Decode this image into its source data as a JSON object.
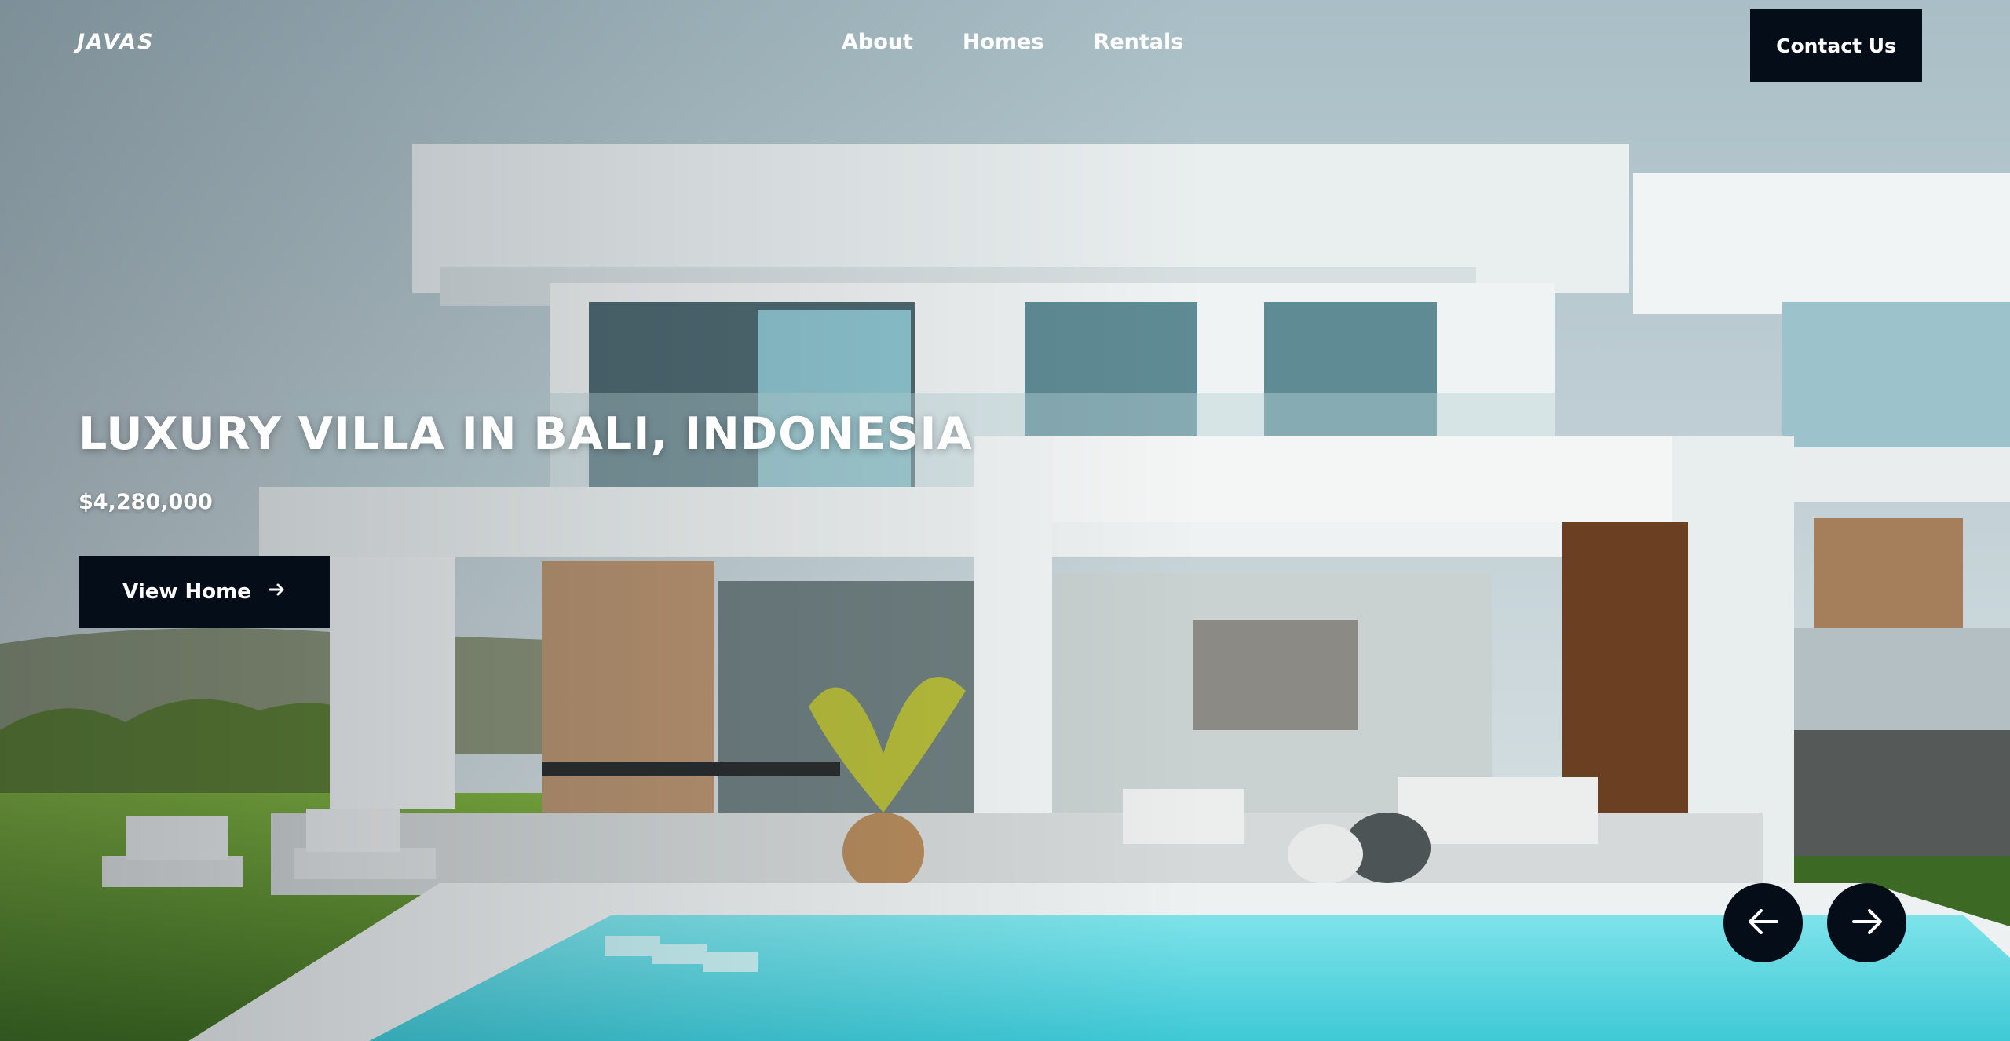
{
  "brand": {
    "logo": "JAVAS"
  },
  "nav": {
    "links": [
      "About",
      "Homes",
      "Rentals"
    ],
    "contact_label": "Contact Us"
  },
  "hero": {
    "title": "LUXURY VILLA IN BALI, INDONESIA",
    "price": "$4,280,000",
    "cta_label": "View Home",
    "cta_icon": "arrow-right-icon"
  },
  "slider": {
    "prev_icon": "arrow-left-icon",
    "next_icon": "arrow-right-icon"
  },
  "colors": {
    "dark": "#050d18",
    "pool": "#5fd6e0",
    "lawn": "#5a8f2a",
    "wall": "#eef2f2"
  }
}
